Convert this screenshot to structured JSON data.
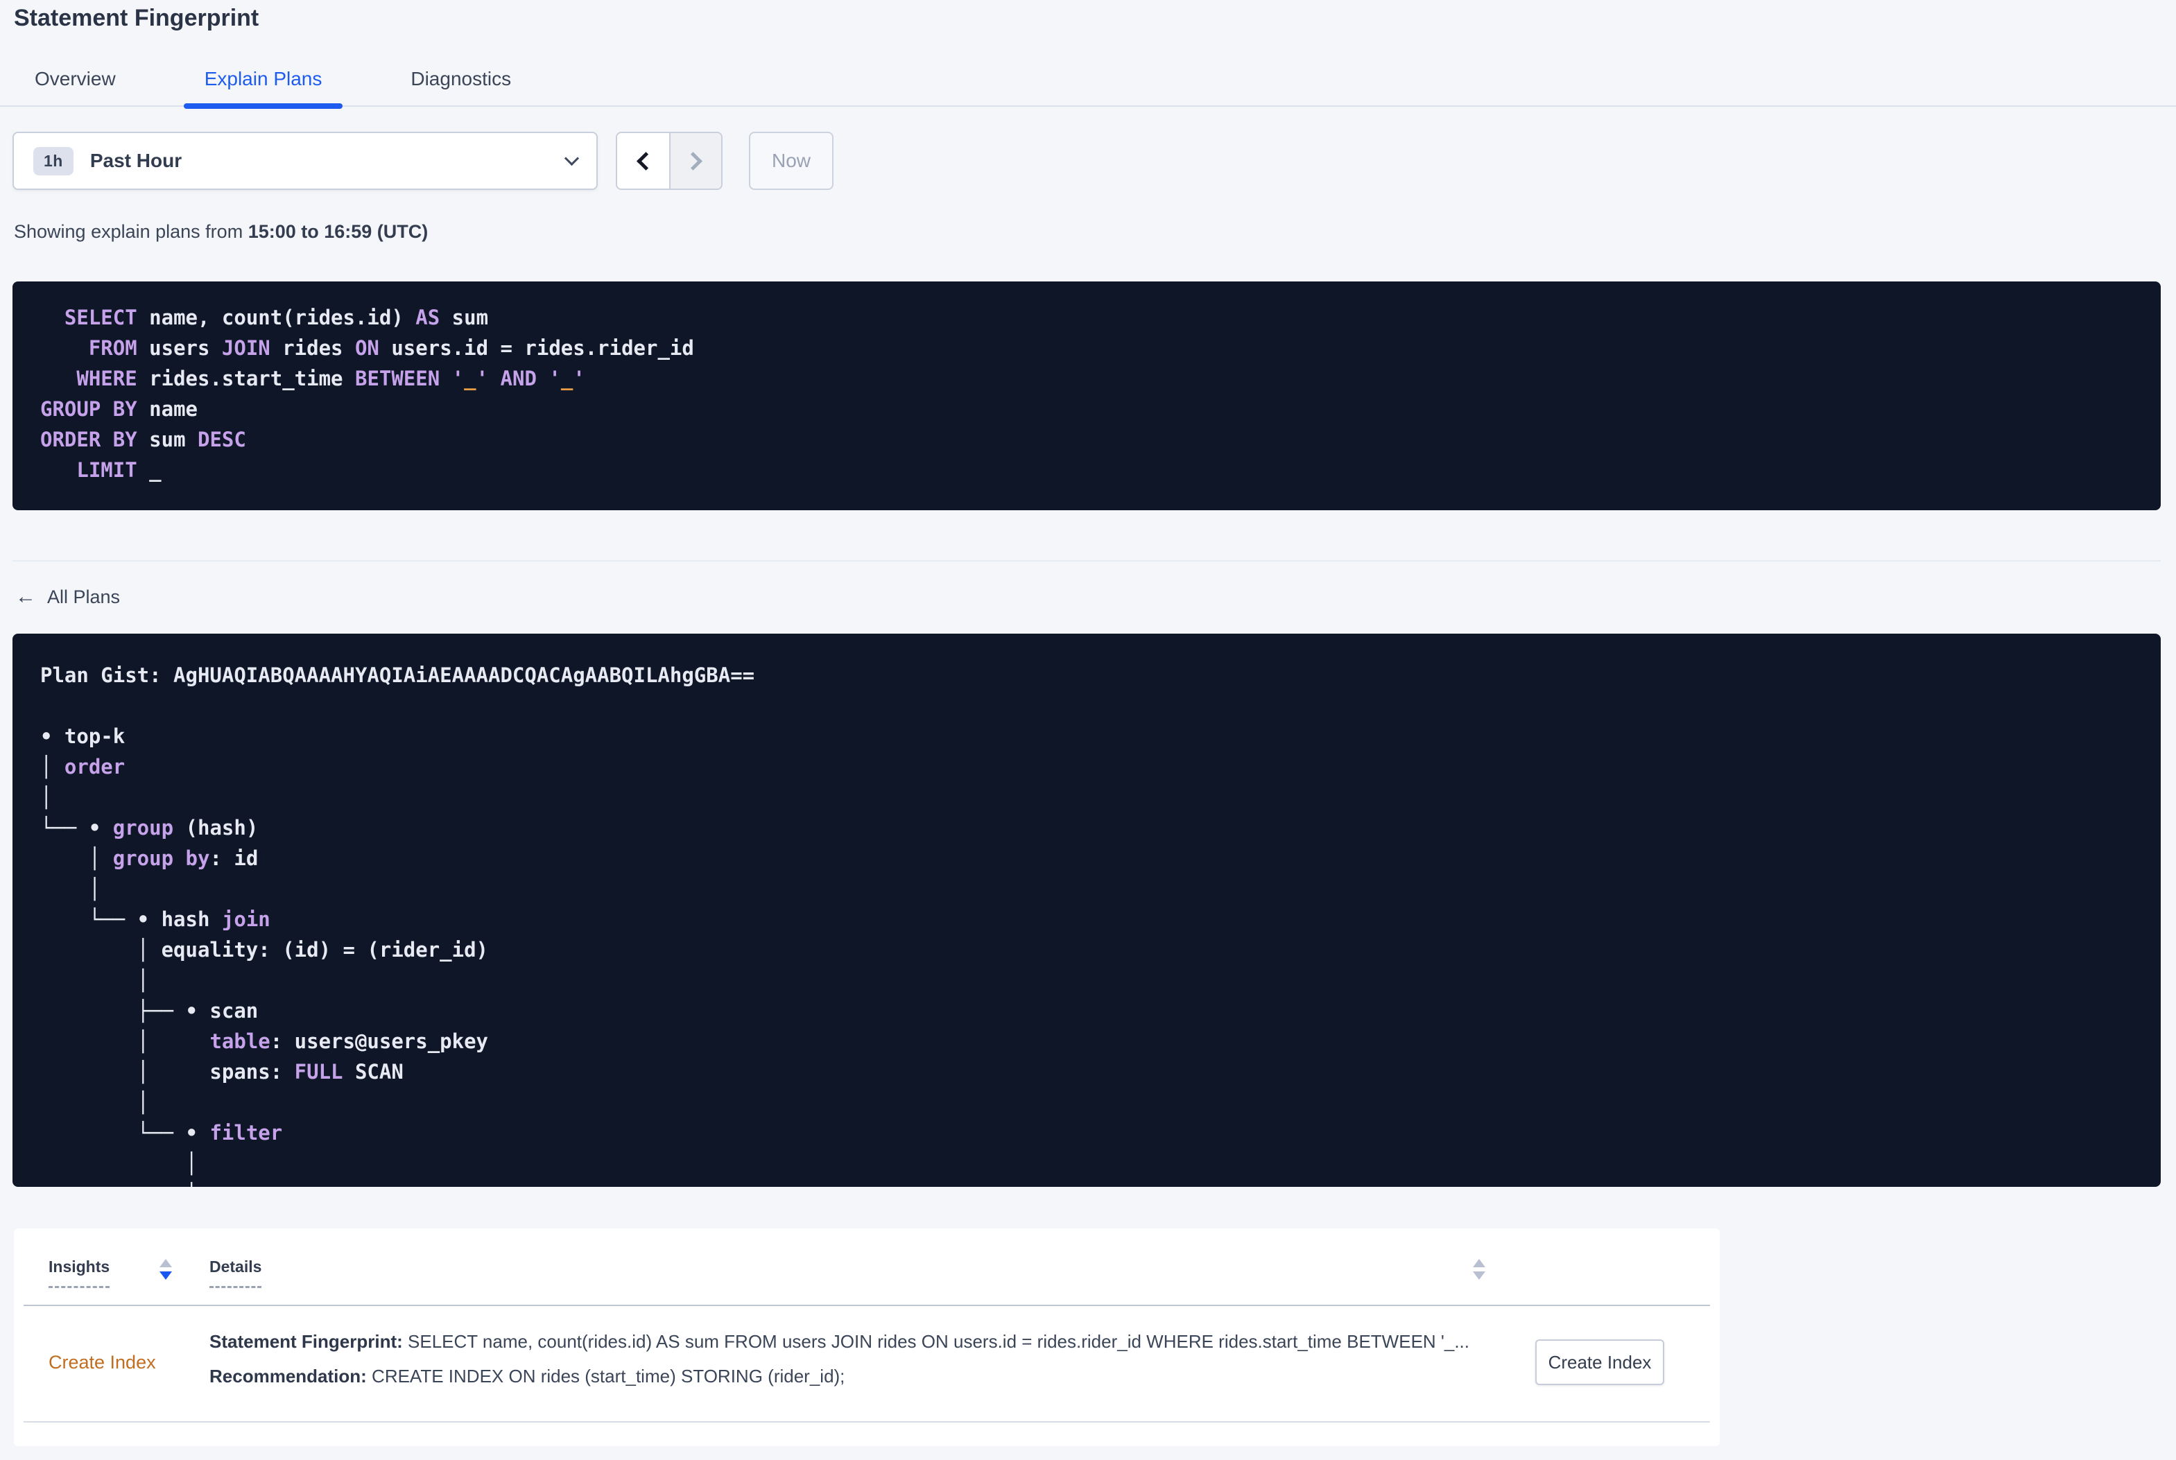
{
  "colors": {
    "accent_blue": "#1e5cf0",
    "insight_orange": "#c26e20",
    "code_background": "#0e1627",
    "code_keyword_purple": "#c5a2e9",
    "code_literal_orange": "#e89c43",
    "code_text_white": "#e7eaf3"
  },
  "header": {
    "title": "Statement Fingerprint"
  },
  "tabs": [
    {
      "label": "Overview",
      "active": false
    },
    {
      "label": "Explain Plans",
      "active": true
    },
    {
      "label": "Diagnostics",
      "active": false
    }
  ],
  "time_picker": {
    "duration_badge": "1h",
    "selected_label": "Past Hour",
    "now_label": "Now"
  },
  "status_line": {
    "prefix": "Showing explain plans from ",
    "range_bold": "15:00 to 16:59 (UTC)"
  },
  "sql_box": {
    "lines": [
      [
        [
          "w",
          "  "
        ],
        [
          "k",
          "SELECT"
        ],
        [
          "w",
          " name, count(rides.id) "
        ],
        [
          "k",
          "AS"
        ],
        [
          "w",
          " sum"
        ]
      ],
      [
        [
          "w",
          "    "
        ],
        [
          "k",
          "FROM"
        ],
        [
          "w",
          " users "
        ],
        [
          "k",
          "JOIN"
        ],
        [
          "w",
          " rides "
        ],
        [
          "k",
          "ON"
        ],
        [
          "w",
          " users.id = rides.rider_id"
        ]
      ],
      [
        [
          "w",
          "   "
        ],
        [
          "k",
          "WHERE"
        ],
        [
          "w",
          " rides.start_time "
        ],
        [
          "k",
          "BETWEEN"
        ],
        [
          "w",
          " "
        ],
        [
          "k",
          "'"
        ],
        [
          "o",
          "_"
        ],
        [
          "k",
          "'"
        ],
        [
          "w",
          " "
        ],
        [
          "k",
          "AND"
        ],
        [
          "w",
          " "
        ],
        [
          "k",
          "'"
        ],
        [
          "o",
          "_"
        ],
        [
          "k",
          "'"
        ]
      ],
      [
        [
          "k",
          "GROUP BY"
        ],
        [
          "w",
          " name"
        ]
      ],
      [
        [
          "k",
          "ORDER BY"
        ],
        [
          "w",
          " sum "
        ],
        [
          "k",
          "DESC"
        ]
      ],
      [
        [
          "w",
          "   "
        ],
        [
          "k",
          "LIMIT"
        ],
        [
          "w",
          " _"
        ]
      ]
    ]
  },
  "all_plans": {
    "arrow_icon": "←",
    "label": "All Plans"
  },
  "plan_box": {
    "lines": [
      [
        [
          "w",
          "Plan Gist: AgHUAQIABQAAAAHYAQIAiAEAAAADCQACAgAABQILAhgGBA=="
        ]
      ],
      [],
      [
        [
          "w",
          "• top-k"
        ]
      ],
      [
        [
          "w",
          "│ "
        ],
        [
          "k",
          "order"
        ]
      ],
      [
        [
          "w",
          "│"
        ]
      ],
      [
        [
          "w",
          "└── • "
        ],
        [
          "k",
          "group"
        ],
        [
          "w",
          " (hash)"
        ]
      ],
      [
        [
          "w",
          "    │ "
        ],
        [
          "k",
          "group by"
        ],
        [
          "w",
          ": id"
        ]
      ],
      [
        [
          "w",
          "    │"
        ]
      ],
      [
        [
          "w",
          "    └── • hash "
        ],
        [
          "k",
          "join"
        ]
      ],
      [
        [
          "w",
          "        │ equality: (id) = (rider_id)"
        ]
      ],
      [
        [
          "w",
          "        │"
        ]
      ],
      [
        [
          "w",
          "        ├── • scan"
        ]
      ],
      [
        [
          "w",
          "        │     "
        ],
        [
          "k",
          "table"
        ],
        [
          "w",
          ": users@users_pkey"
        ]
      ],
      [
        [
          "w",
          "        │     spans: "
        ],
        [
          "k",
          "FULL"
        ],
        [
          "w",
          " SCAN"
        ]
      ],
      [
        [
          "w",
          "        │"
        ]
      ],
      [
        [
          "w",
          "        └── • "
        ],
        [
          "k",
          "filter"
        ]
      ],
      [
        [
          "w",
          "            │"
        ]
      ],
      [
        [
          "w",
          "            │"
        ]
      ]
    ]
  },
  "insights_table": {
    "columns": [
      {
        "label": "Insights"
      },
      {
        "label": "Details"
      }
    ],
    "rows": [
      {
        "insight": "Create Index",
        "statement_label": "Statement Fingerprint:",
        "statement_text": " SELECT name, count(rides.id) AS sum FROM users JOIN rides ON users.id = rides.rider_id WHERE rides.start_time BETWEEN '_...",
        "recommendation_label": "Recommendation:",
        "recommendation_text": " CREATE INDEX ON rides (start_time) STORING (rider_id);",
        "action_label": "Create Index"
      }
    ]
  }
}
